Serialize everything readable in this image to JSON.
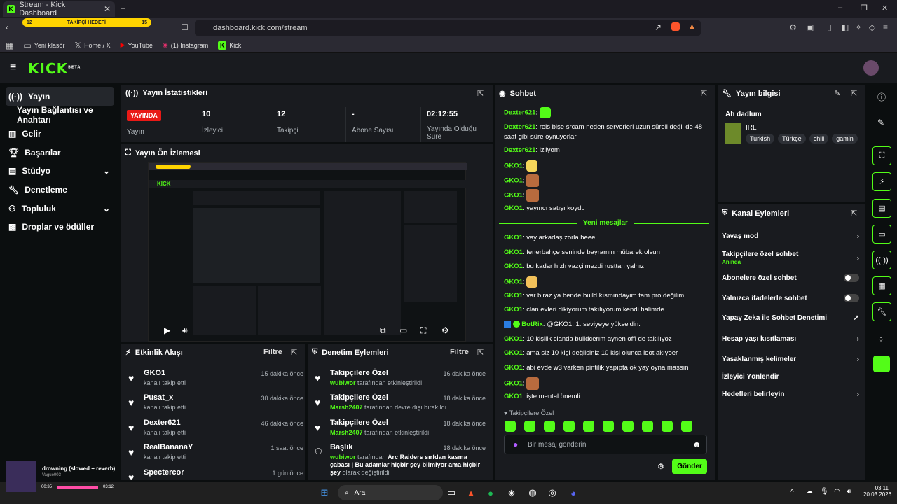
{
  "browser": {
    "tab_title": "Stream - Kick Dashboard",
    "url": "dashboard.kick.com/stream",
    "goal_count": "12",
    "goal_label": "TAKİPÇİ HEDEFİ",
    "goal_target": "15",
    "bookmarks": [
      "Yeni klasör",
      "Home / X",
      "YouTube",
      "(1) Instagram",
      "Kick"
    ]
  },
  "kick": {
    "logo": "KICK",
    "beta": "BETA"
  },
  "sidebar": {
    "items": [
      {
        "label": "Yayın"
      },
      {
        "label": "Yayın Bağlantısı ve Anahtarı"
      },
      {
        "label": "Gelir"
      },
      {
        "label": "Başarılar"
      },
      {
        "label": "Stüdyo"
      },
      {
        "label": "Denetleme"
      },
      {
        "label": "Topluluk"
      },
      {
        "label": "Droplar ve ödüller"
      }
    ]
  },
  "stats": {
    "title": "Yayın İstatistikleri",
    "live_badge": "YAYINDA",
    "live_label": "Yayın",
    "viewers_value": "10",
    "viewers_label": "İzleyici",
    "followers_value": "12",
    "followers_label": "Takipçi",
    "subs_value": "-",
    "subs_label": "Abone Sayısı",
    "time_value": "02:12:55",
    "time_label": "Yayında Olduğu Süre"
  },
  "preview": {
    "title": "Yayın Ön İzlemesi"
  },
  "activity": {
    "title": "Etkinlik Akışı",
    "filter": "Filtre",
    "items": [
      {
        "name": "GKO1",
        "sub": "kanalı takip etti",
        "time": "15 dakika önce"
      },
      {
        "name": "Pusat_x",
        "sub": "kanalı takip etti",
        "time": "30 dakika önce"
      },
      {
        "name": "Dexter621",
        "sub": "kanalı takip etti",
        "time": "46 dakika önce"
      },
      {
        "name": "RealBananaY",
        "sub": "kanalı takip etti",
        "time": "1 saat önce"
      },
      {
        "name": "Spectercor",
        "sub": "",
        "time": "1 gün önce"
      }
    ]
  },
  "moderation": {
    "title": "Denetim Eylemleri",
    "filter": "Filtre",
    "items": [
      {
        "name": "Takipçilere Özel",
        "user": "wubiwor",
        "sub": "tarafından etkinleştirildi",
        "time": "16 dakika önce"
      },
      {
        "name": "Takipçilere Özel",
        "user": "Marsh2407",
        "sub": "tarafından devre dışı bırakıldı",
        "time": "18 dakika önce"
      },
      {
        "name": "Takipçilere Özel",
        "user": "Marsh2407",
        "sub": "tarafından etkinleştirildi",
        "time": "18 dakika önce"
      },
      {
        "name": "Başlık",
        "user": "wubiwor",
        "sub": "tarafından",
        "detail": "Arc Raiders sırfdan kasma çabası | Bu adamlar hiçbir şey bilmiyor ama hiçbir şey",
        "sub2": "olarak değiştirildi",
        "time": "18 dakika önce"
      }
    ]
  },
  "chat": {
    "title": "Sohbet",
    "messages": [
      {
        "user": "Dexter621",
        "text": ""
      },
      {
        "user": "Dexter621",
        "text": "reis bişe srcam neden serverleri uzun süreli değil de 48 saat gibi süre oynuyorlar"
      },
      {
        "user": "Dexter621",
        "text": "izliyom"
      },
      {
        "user": "GKO1",
        "text": ""
      },
      {
        "user": "GKO1",
        "text": ""
      },
      {
        "user": "GKO1",
        "text": ""
      },
      {
        "user": "GKO1",
        "text": "yayıncı satışı koydu"
      }
    ],
    "new_messages": "Yeni mesajlar",
    "messages2": [
      {
        "user": "GKO1",
        "text": "vay arkadaş zorla heee"
      },
      {
        "user": "GKO1",
        "text": "fenerbahçe seninde bayramın mübarek olsun"
      },
      {
        "user": "GKO1",
        "text": "bu kadar hızlı vazçilmezdi rusttan yalnız"
      },
      {
        "user": "GKO1",
        "text": ""
      },
      {
        "user": "GKO1",
        "text": "var biraz ya bende build kısmındayım tam pro değilim"
      },
      {
        "user": "GKO1",
        "text": "clan evleri dikiyorum takılıyorum kendi halimde"
      },
      {
        "user": "BotRix",
        "text": "@GKO1, 1. seviyeye yükseldin."
      },
      {
        "user": "GKO1",
        "text": "10 kişilik clanda buildcerım aynen offi de takılıyoz"
      },
      {
        "user": "GKO1",
        "text": "ama siz 10 kişi değilsiniz 10 kişi olunca loot akıyoer"
      },
      {
        "user": "GKO1",
        "text": "abi evde w3 varken pintilik yapıpta ok yay oyna massın"
      },
      {
        "user": "GKO1",
        "text": ""
      },
      {
        "user": "GKO1",
        "text": "işte mental önemli"
      }
    ],
    "followers_only": "Takipçilere Özel",
    "input_placeholder": "Bir mesaj gönderin",
    "send": "Gönder"
  },
  "info": {
    "title": "Yayın bilgisi",
    "stream_title": "Ah dadlum",
    "category": "IRL",
    "tags": [
      "Turkish",
      "Türkçe",
      "chill",
      "gamin"
    ]
  },
  "actions": {
    "title": "Kanal Eylemleri",
    "items": [
      {
        "label": "Yavaş mod"
      },
      {
        "label": "Takipçilere özel sohbet",
        "sub": "Anında"
      },
      {
        "label": "Abonelere özel sohbet"
      },
      {
        "label": "Yalnızca ifadelerle sohbet"
      },
      {
        "label": "Yapay Zeka ile Sohbet Denetimi"
      },
      {
        "label": "Hesap yaşı kısıtlaması"
      },
      {
        "label": "Yasaklanmış kelimeler"
      },
      {
        "label": "İzleyici Yönlendir"
      },
      {
        "label": "Hedefleri belirleyin"
      }
    ]
  },
  "music": {
    "title": "drowning (slowed + reverb)",
    "artist": "Vague003",
    "elapsed": "00:35",
    "total": "03:12"
  },
  "taskbar": {
    "search": "Ara",
    "time": "03:11",
    "date": "20.03.2026"
  },
  "colors": {
    "accent": "#53fc18",
    "live": "#e91916",
    "panel": "#191b1f"
  }
}
